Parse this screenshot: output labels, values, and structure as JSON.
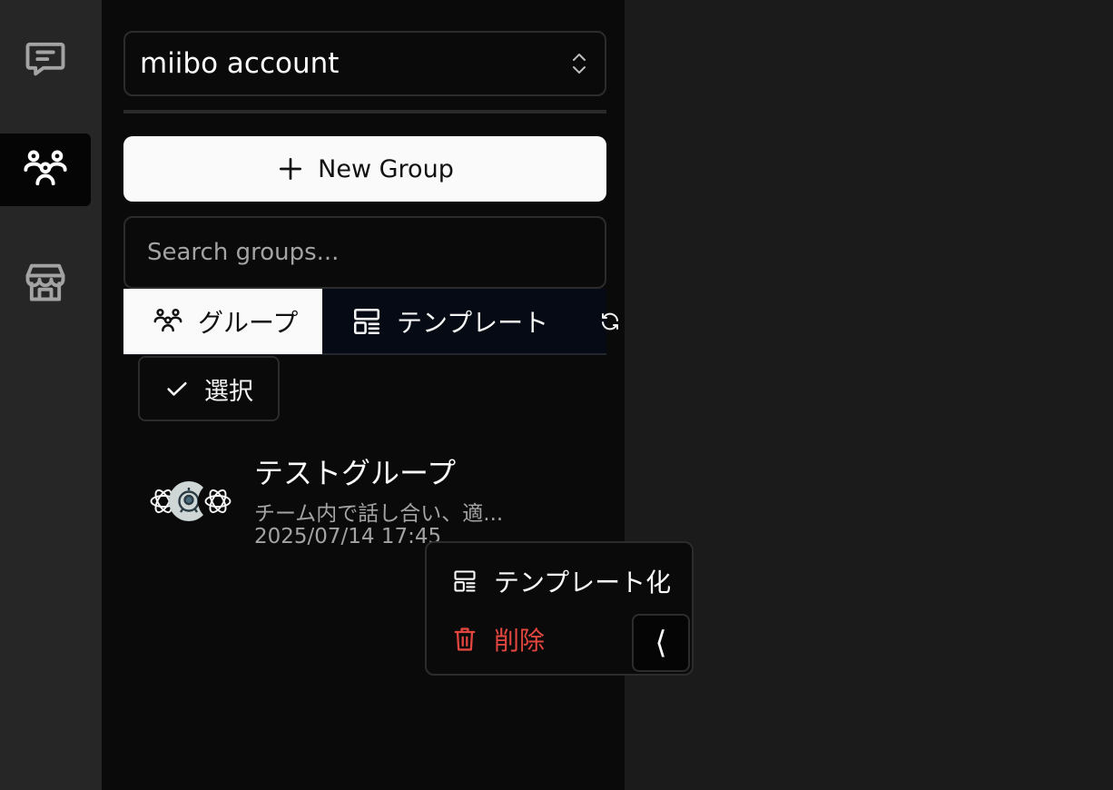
{
  "rail": {
    "items": [
      {
        "icon": "chat-icon",
        "active": false
      },
      {
        "icon": "users-icon",
        "active": true
      },
      {
        "icon": "store-icon",
        "active": false
      }
    ]
  },
  "account": {
    "name": "miibo account"
  },
  "actions": {
    "new_group_label": "New Group"
  },
  "search": {
    "placeholder": "Search groups..."
  },
  "tabs": [
    {
      "label": "グループ",
      "icon": "users-icon",
      "active": true
    },
    {
      "label": "テンプレート",
      "icon": "template-icon",
      "active": false
    }
  ],
  "select_label": "選択",
  "groups": [
    {
      "title": "テストグループ",
      "description": "チーム内で話し合い、適...",
      "date": "2025/07/14 17:45",
      "avatars": [
        "openai-icon",
        "robot-avatar",
        "openai-icon"
      ]
    }
  ],
  "context_menu": {
    "items": [
      {
        "label": "テンプレート化",
        "icon": "template-icon"
      },
      {
        "label": "削除",
        "icon": "trash-icon"
      }
    ]
  },
  "collapse_label": "⟨",
  "colors": {
    "accent_danger": "#e2463f",
    "panel_bg": "#0a0a0a",
    "rail_bg": "#262626"
  }
}
